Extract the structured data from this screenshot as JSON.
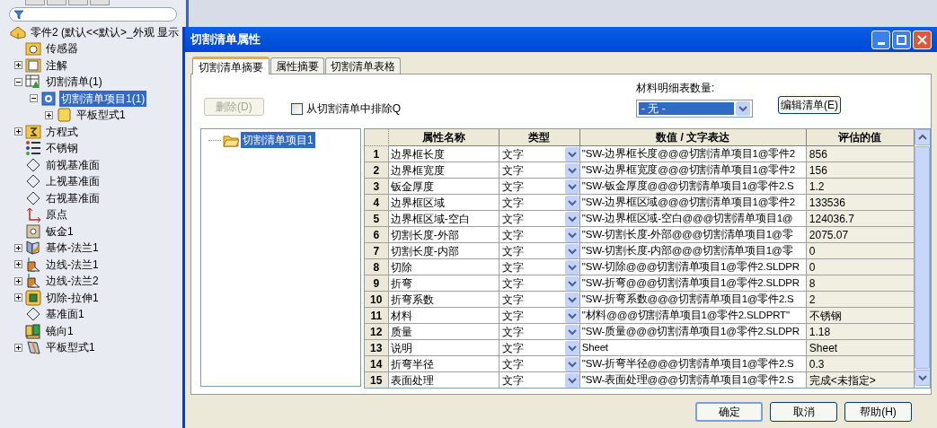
{
  "tree": {
    "root": "零件2 (默认<<默认>_外观 显示",
    "items": [
      {
        "label": "传感器",
        "kind": "leaf",
        "selected": false
      },
      {
        "label": "注解",
        "kind": "branch",
        "expanded": false,
        "selected": false
      },
      {
        "label": "切割清单(1)",
        "kind": "branch",
        "expanded": true,
        "selected": false,
        "children": [
          {
            "label": "切割清单项目1(1)",
            "kind": "branch",
            "expanded": true,
            "selected": true,
            "children": [
              {
                "label": "平板型式1",
                "kind": "branch",
                "expanded": false,
                "selected": false
              }
            ]
          }
        ]
      },
      {
        "label": "方程式",
        "kind": "branch",
        "expanded": false,
        "selected": false
      },
      {
        "label": "不锈钢",
        "kind": "leaf",
        "selected": false
      },
      {
        "label": "前视基准面",
        "kind": "leaf",
        "selected": false
      },
      {
        "label": "上视基准面",
        "kind": "leaf",
        "selected": false
      },
      {
        "label": "右视基准面",
        "kind": "leaf",
        "selected": false
      },
      {
        "label": "原点",
        "kind": "leaf",
        "selected": false
      },
      {
        "label": "钣金1",
        "kind": "leaf",
        "selected": false
      },
      {
        "label": "基体-法兰1",
        "kind": "branch",
        "expanded": false,
        "selected": false
      },
      {
        "label": "边线-法兰1",
        "kind": "branch",
        "expanded": false,
        "selected": false
      },
      {
        "label": "边线-法兰2",
        "kind": "branch",
        "expanded": false,
        "selected": false
      },
      {
        "label": "切除-拉伸1",
        "kind": "branch",
        "expanded": false,
        "selected": false
      },
      {
        "label": "基准面1",
        "kind": "leaf",
        "selected": false
      },
      {
        "label": "镜向1",
        "kind": "leaf",
        "selected": false
      },
      {
        "label": "平板型式1",
        "kind": "branch",
        "expanded": false,
        "selected": false
      }
    ]
  },
  "dialog": {
    "title": "切割清单属性",
    "tabs": [
      {
        "label": "切割清单摘要",
        "selected": true
      },
      {
        "label": "属性摘要",
        "selected": false
      },
      {
        "label": "切割清单表格",
        "selected": false
      }
    ],
    "delete_button": {
      "label": "删除(D)",
      "disabled": true
    },
    "exclude_checkbox": {
      "label": "从切割清单中排除Q",
      "checked": false
    },
    "bom_quantity": {
      "label": "材料明细表数量:",
      "value": "- 无 -"
    },
    "edit_list_button": "编辑清单(E)",
    "cut_list_tree": [
      {
        "label": "切割清单项目1",
        "selected": true
      }
    ],
    "table": {
      "columns": [
        "属性名称",
        "类型",
        "数值 / 文字表达",
        "评估的值"
      ],
      "rows": [
        {
          "num": "1",
          "name": "边界框长度",
          "type": "文字",
          "value": "\"SW-边界框长度@@@切割清单项目1@零件2",
          "evaluated": "856"
        },
        {
          "num": "2",
          "name": "边界框宽度",
          "type": "文字",
          "value": "\"SW-边界框宽度@@@切割清单项目1@零件2",
          "evaluated": "156"
        },
        {
          "num": "3",
          "name": "钣金厚度",
          "type": "文字",
          "value": "\"SW-钣金厚度@@@切割清单项目1@零件2.S",
          "evaluated": "1.2"
        },
        {
          "num": "4",
          "name": "边界框区域",
          "type": "文字",
          "value": "\"SW-边界框区域@@@切割清单项目1@零件2",
          "evaluated": "133536"
        },
        {
          "num": "5",
          "name": "边界框区域-空白",
          "type": "文字",
          "value": "\"SW-边界框区域-空白@@@切割清单项目1@",
          "evaluated": "124036.7"
        },
        {
          "num": "6",
          "name": "切割长度-外部",
          "type": "文字",
          "value": "\"SW-切割长度-外部@@@切割清单项目1@零",
          "evaluated": "2075.07"
        },
        {
          "num": "7",
          "name": "切割长度-内部",
          "type": "文字",
          "value": "\"SW-切割长度-内部@@@切割清单项目1@零",
          "evaluated": "0"
        },
        {
          "num": "8",
          "name": "切除",
          "type": "文字",
          "value": "\"SW-切除@@@切割清单项目1@零件2.SLDPR",
          "evaluated": "0"
        },
        {
          "num": "9",
          "name": "折弯",
          "type": "文字",
          "value": "\"SW-折弯@@@切割清单项目1@零件2.SLDPR",
          "evaluated": "8"
        },
        {
          "num": "10",
          "name": "折弯系数",
          "type": "文字",
          "value": "\"SW-折弯系数@@@切割清单项目1@零件2.S",
          "evaluated": "2"
        },
        {
          "num": "11",
          "name": "材料",
          "type": "文字",
          "value": "\"材料@@@切割清单项目1@零件2.SLDPRT\"",
          "evaluated": "不锈钢"
        },
        {
          "num": "12",
          "name": "质量",
          "type": "文字",
          "value": "\"SW-质量@@@切割清单项目1@零件2.SLDPR",
          "evaluated": "1.18"
        },
        {
          "num": "13",
          "name": "说明",
          "type": "文字",
          "value": "Sheet",
          "evaluated": "Sheet"
        },
        {
          "num": "14",
          "name": "折弯半径",
          "type": "文字",
          "value": "\"SW-折弯半径@@@切割清单项目1@零件2.S",
          "evaluated": "0.3"
        },
        {
          "num": "15",
          "name": "表面处理",
          "type": "文字",
          "value": "\"SW-表面处理@@@切割清单项目1@零件2.S",
          "evaluated": "完成<未指定>"
        }
      ]
    },
    "buttons": [
      "确定",
      "取消",
      "帮助(H)"
    ]
  }
}
